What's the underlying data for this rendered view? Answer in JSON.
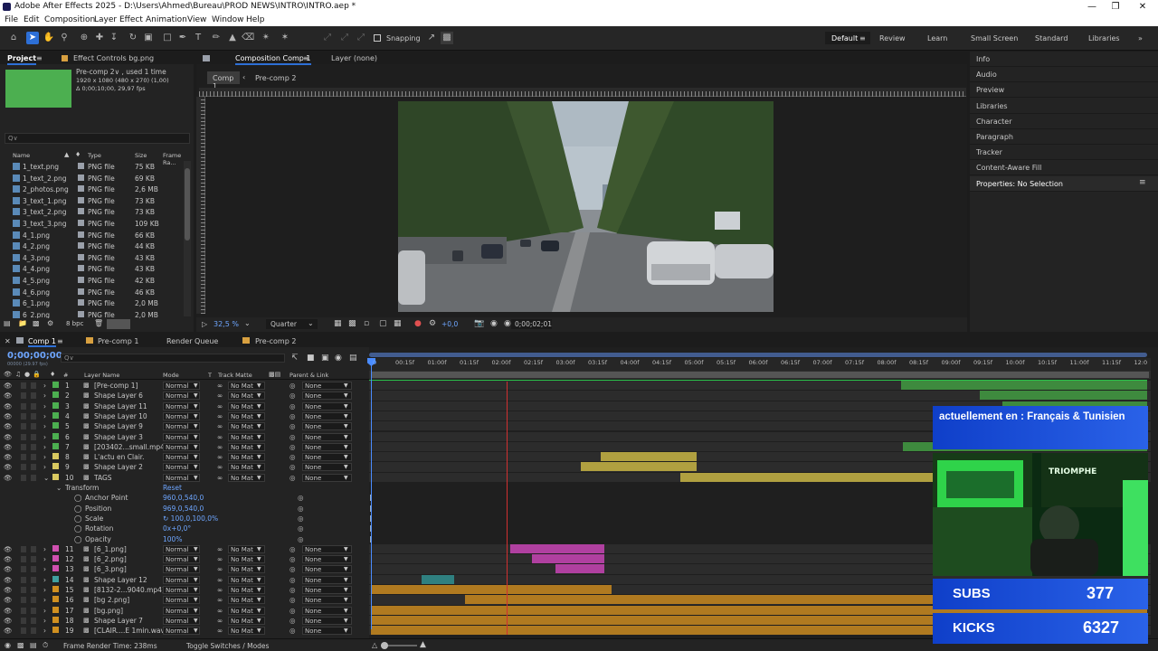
{
  "titlebar": {
    "title": "Adobe After Effects 2025 - D:\\Users\\Ahmed\\Bureau\\PROD NEWS\\INTRO\\INTRO.aep *"
  },
  "menu": [
    "File",
    "Edit",
    "Composition",
    "Layer",
    "Effect",
    "Animation",
    "View",
    "Window",
    "Help"
  ],
  "toolbar": {
    "snapping": "Snapping"
  },
  "workspaces": [
    "Default",
    "Review",
    "Learn",
    "Small Screen",
    "Standard",
    "Libraries"
  ],
  "project": {
    "tab": "Project",
    "effect_tab": "Effect Controls bg.png",
    "info_name": "Pre-comp 2∨ , used 1 time",
    "info_size": "1920 x 1080  (480 x 270) (1,00)",
    "info_dur": "Δ 0;00;10;00, 29,97 fps",
    "search_placeholder": "Q∨",
    "headers": {
      "name": "Name",
      "type": "Type",
      "size": "Size",
      "rate": "Frame Ra..."
    },
    "files": [
      {
        "name": "1_text.png",
        "type": "PNG file",
        "size": "75 KB"
      },
      {
        "name": "1_text_2.png",
        "type": "PNG file",
        "size": "69 KB"
      },
      {
        "name": "2_photos.png",
        "type": "PNG file",
        "size": "2,6 MB"
      },
      {
        "name": "3_text_1.png",
        "type": "PNG file",
        "size": "73 KB"
      },
      {
        "name": "3_text_2.png",
        "type": "PNG file",
        "size": "73 KB"
      },
      {
        "name": "3_text_3.png",
        "type": "PNG file",
        "size": "109 KB"
      },
      {
        "name": "4_1.png",
        "type": "PNG file",
        "size": "66 KB"
      },
      {
        "name": "4_2.png",
        "type": "PNG file",
        "size": "44 KB"
      },
      {
        "name": "4_3.png",
        "type": "PNG file",
        "size": "43 KB"
      },
      {
        "name": "4_4.png",
        "type": "PNG file",
        "size": "43 KB"
      },
      {
        "name": "4_5.png",
        "type": "PNG file",
        "size": "42 KB"
      },
      {
        "name": "4_6.png",
        "type": "PNG file",
        "size": "46 KB"
      },
      {
        "name": "6_1.png",
        "type": "PNG file",
        "size": "2,0 MB"
      },
      {
        "name": "6_2.png",
        "type": "PNG file",
        "size": "2,0 MB"
      }
    ],
    "bpc": "8 bpc"
  },
  "composition": {
    "tab": "Composition Comp 1",
    "layer_tab": "Layer (none)",
    "breadcrumbs": [
      "Comp 1",
      "Pre-comp 2"
    ],
    "zoom": "32,5 %",
    "quality": "Quarter",
    "exposure": "+0,0",
    "timecode": "0;00;02;01"
  },
  "right_panels": [
    "Info",
    "Audio",
    "Preview",
    "Libraries",
    "Character",
    "Paragraph",
    "Tracker",
    "Content-Aware Fill",
    "Properties: No Selection"
  ],
  "timeline": {
    "tabs": [
      "Comp 1",
      "Pre-comp 1",
      "Render Queue",
      "Pre-comp 2"
    ],
    "timecode": "0;00;00;00",
    "fps": "00000 (29.97 fps)",
    "search_placeholder": "Q∨",
    "headers": {
      "num": "#",
      "name": "Layer Name",
      "mode": "Mode",
      "t": "T",
      "matte": "Track Matte",
      "parent": "Parent & Link"
    },
    "ruler": [
      "00:15f",
      "01:00f",
      "01:15f",
      "02:00f",
      "02:15f",
      "03:00f",
      "03:15f",
      "04:00f",
      "04:15f",
      "05:00f",
      "05:15f",
      "06:00f",
      "06:15f",
      "07:00f",
      "07:15f",
      "08:00f",
      "08:15f",
      "09:00f",
      "09:15f",
      "10:00f",
      "10:15f",
      "11:00f",
      "11:15f",
      "12:0"
    ],
    "mode_val": "Normal",
    "matte_val": "No Mat",
    "parent_val": "None",
    "layers": [
      {
        "n": "1",
        "name": "[Pre-comp 1]",
        "color": "#4caf50"
      },
      {
        "n": "2",
        "name": "Shape Layer 6",
        "color": "#4caf50"
      },
      {
        "n": "3",
        "name": "Shape Layer 11",
        "color": "#4caf50"
      },
      {
        "n": "4",
        "name": "Shape Layer 10",
        "color": "#4caf50"
      },
      {
        "n": "5",
        "name": "Shape Layer 9",
        "color": "#4caf50"
      },
      {
        "n": "6",
        "name": "Shape Layer 3",
        "color": "#4caf50"
      },
      {
        "n": "7",
        "name": "[203402...small.mp4]",
        "color": "#4caf50"
      },
      {
        "n": "8",
        "name": "L'actu en Clair.",
        "color": "#d8c860"
      },
      {
        "n": "9",
        "name": "Shape Layer 2",
        "color": "#d8c860"
      },
      {
        "n": "10",
        "name": "TAGS",
        "color": "#d8c860"
      }
    ],
    "transform": {
      "label": "Transform",
      "reset": "Reset",
      "props": [
        {
          "name": "Anchor Point",
          "value": "960,0,540,0"
        },
        {
          "name": "Position",
          "value": "969,0,540,0"
        },
        {
          "name": "Scale",
          "value": "↻ 100,0,100,0%"
        },
        {
          "name": "Rotation",
          "value": "0x+0,0°"
        },
        {
          "name": "Opacity",
          "value": "100%"
        }
      ]
    },
    "layers2": [
      {
        "n": "11",
        "name": "[6_1.png]",
        "color": "#d050b0"
      },
      {
        "n": "12",
        "name": "[6_2.png]",
        "color": "#d050b0"
      },
      {
        "n": "13",
        "name": "[6_3.png]",
        "color": "#d050b0"
      },
      {
        "n": "14",
        "name": "Shape Layer 12",
        "color": "#40a0a0"
      },
      {
        "n": "15",
        "name": "[8132-2...9040.mp4]",
        "color": "#d09020"
      },
      {
        "n": "16",
        "name": "[bg 2.png]",
        "color": "#d09020"
      },
      {
        "n": "17",
        "name": "[bg.png]",
        "color": "#d09020"
      },
      {
        "n": "18",
        "name": "Shape Layer 7",
        "color": "#d09020"
      },
      {
        "n": "19",
        "name": "[CLAIR....E 1min.wav]",
        "color": "#d09020"
      }
    ],
    "footer": {
      "render_time": "Frame Render Time: 238ms",
      "toggle": "Toggle Switches / Modes"
    }
  },
  "overlay": {
    "language": "actuellement en : Français & Tunisien",
    "cam_sign": "TRIOMPHE",
    "subs_label": "SUBS",
    "subs_value": "377",
    "kicks_label": "KICKS",
    "kicks_value": "6327"
  }
}
